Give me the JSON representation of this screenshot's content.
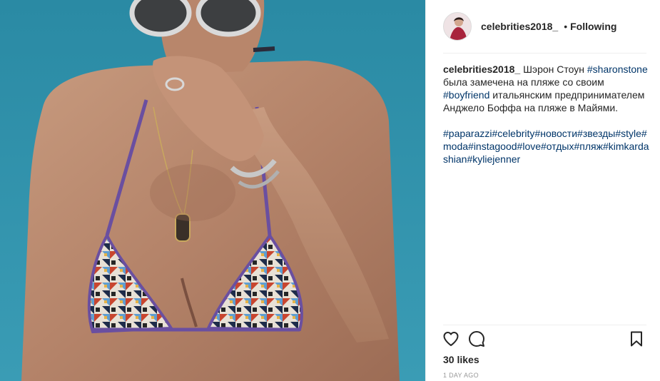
{
  "header": {
    "username": "celebrities2018_",
    "separator": "•",
    "follow_status": "Following"
  },
  "caption": {
    "username": "celebrities2018_",
    "text_1": " Шэрон Стоун ",
    "tag_1": "#sharonstone",
    "text_2": " была замечена на пляже со своим ",
    "tag_2": "#boyfriend",
    "text_3": " итальянским предпринимателем Анджело Боффа на пляже в Майями.",
    "hashtags": [
      "#paparazzi",
      "#celebrity",
      "#новости",
      "#звезды",
      "#style",
      "#moda",
      "#instagood",
      "#love",
      "#отдых",
      "#пляж",
      "#kimkardashian",
      "#kyliejenner"
    ]
  },
  "actions": {
    "like_icon": "heart-icon",
    "comment_icon": "comment-icon",
    "save_icon": "bookmark-icon"
  },
  "likes": "30 likes",
  "timestamp": "1 DAY AGO",
  "colors": {
    "hashtag": "#003569",
    "text": "#262626",
    "muted": "#999999",
    "divider": "#efefef"
  }
}
